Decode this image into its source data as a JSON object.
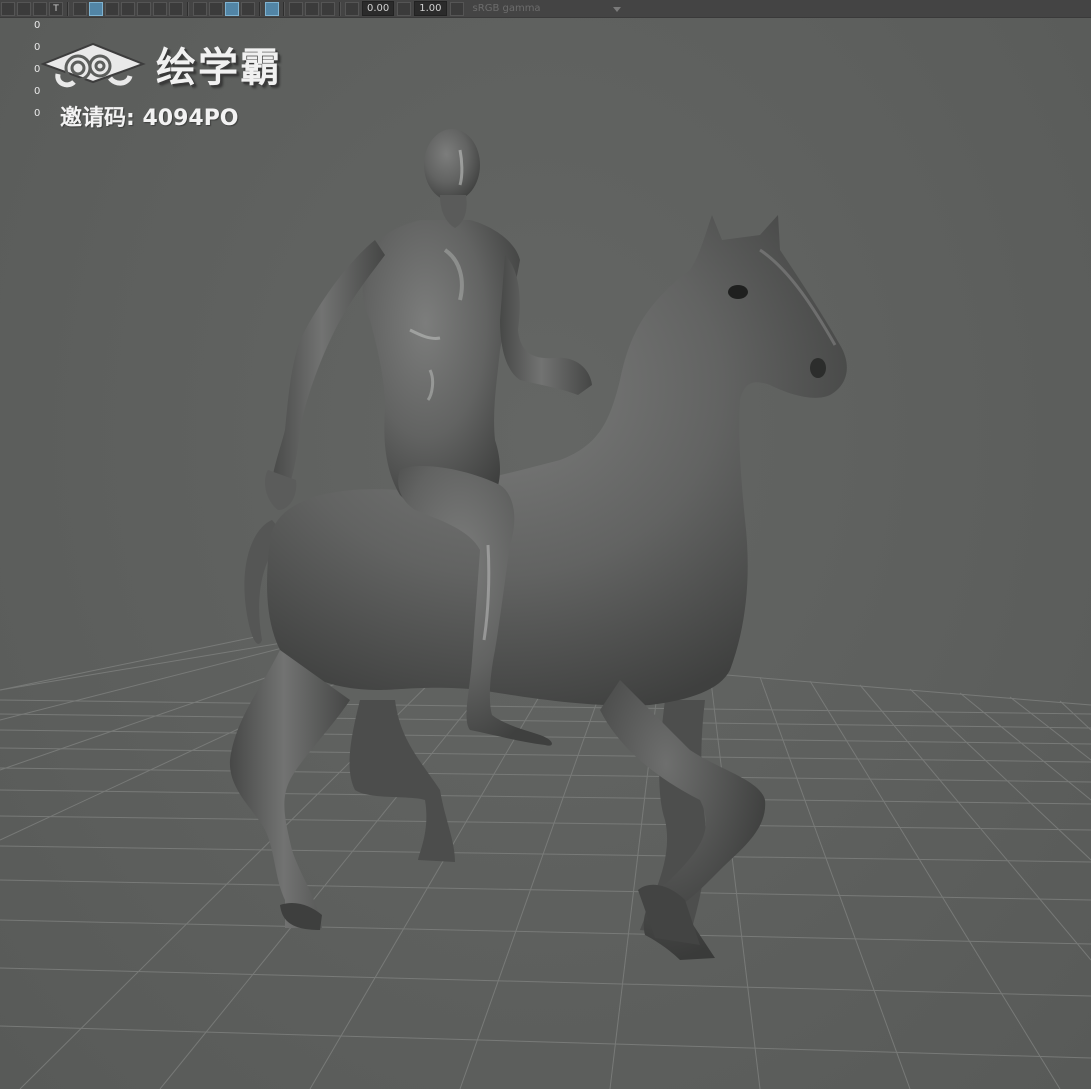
{
  "toolbar": {
    "exposure_value": "0.00",
    "gamma_value": "1.00",
    "color_space": "sRGB gamma",
    "text_icon_glyph": "T"
  },
  "hud": {
    "counts": [
      "0",
      "0",
      "0",
      "0",
      "0"
    ]
  },
  "watermark": {
    "brand_name": "绘学霸",
    "invite_label": "邀请码: 4094PO"
  },
  "icons": {
    "logo": "graduation-cap-cloud-logo",
    "tb": [
      "camera-attr",
      "bookmark",
      "image-plane",
      "text",
      "wireframe-cube",
      "smooth-shade-cube",
      "texture",
      "light",
      "shadow",
      "ambient-occlusion",
      "motion-blur",
      "antialias",
      "isolate",
      "xray",
      "grid",
      "exposure",
      "gamma",
      "color-management"
    ]
  },
  "colors": {
    "viewport_bg": "#5e605e",
    "toolbar_bg": "#444444",
    "active_icon": "#5285a6",
    "model": "#6a6b6a"
  }
}
